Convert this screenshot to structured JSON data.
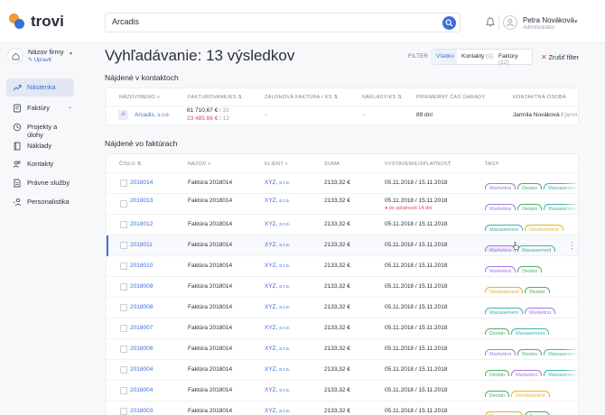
{
  "app": {
    "name": "trovi"
  },
  "search": {
    "value": "Arcadis"
  },
  "user": {
    "name": "Petra Nováková",
    "role": "Administrátor"
  },
  "company": {
    "name": "Názov firmy",
    "edit": "✎ Upraviť"
  },
  "nav": [
    {
      "label": "Nástenka",
      "icon": "trend-icon",
      "active": true
    },
    {
      "label": "Faktúry",
      "icon": "invoice-icon",
      "caret": "⌄"
    },
    {
      "label": "Projekty a úlohy",
      "icon": "clock-icon"
    },
    {
      "label": "Náklady",
      "icon": "book-icon"
    },
    {
      "label": "Kontakty",
      "icon": "people-icon"
    },
    {
      "label": "Právne služby",
      "icon": "document-icon"
    },
    {
      "label": "Personalistika",
      "icon": "person-link-icon"
    }
  ],
  "page": {
    "title": "Vyhľadávanie: 13 výsledkov"
  },
  "filter": {
    "label": "FILTER",
    "options": [
      {
        "label": "Všetko",
        "count": ""
      },
      {
        "label": "Kontakty",
        "count": "(1)"
      },
      {
        "label": "Faktúry",
        "count": "(12)"
      }
    ],
    "clear": "Zrušiť filter"
  },
  "contacts_section": {
    "title": "Nájdené v kontaktoch",
    "headers": [
      "NÁZOV/MENO",
      "FAKTUROVANÉ/KS",
      "ZÁLOHOVÁ FAKTÚRA / KS",
      "NÁKLADY/KS",
      "PRIEMERNÝ ČAS ÚHRADY",
      "KONTAKTNÁ OSOBA"
    ],
    "row": {
      "badge": "A",
      "name": "Arcadis, s.r.o.",
      "invoiced": "61 710,67 €",
      "invoiced_count": "/ 32",
      "invoiced_overdue": "23 485,66 €",
      "invoiced_overdue_count": "/ 12",
      "advance": "–",
      "costs": "–",
      "avg_time": "89 dní",
      "person": "Jarmila Nováková /",
      "person_extra": "jarmi"
    }
  },
  "invoices_section": {
    "title": "Nájdené vo faktúrach",
    "headers": [
      "ČÍSLO",
      "NÁZOV",
      "KLIENT",
      "SUMA",
      "VYSTAVENIE/SPLATNOSŤ",
      "TAGY"
    ],
    "rows": [
      {
        "number": "2018014",
        "name": "Faktúra 2018014",
        "client": "XYZ,",
        "client_suffix": "s.r.o.",
        "amount": "2133,32 €",
        "dates": "05.11.2018 / 15.11.2018",
        "note": "",
        "tags": [
          "Marketing",
          "Design",
          "Management"
        ]
      },
      {
        "number": "2018013",
        "name": "Faktúra 2018014",
        "client": "XYZ,",
        "client_suffix": "s.r.o.",
        "amount": "2133,32 €",
        "dates": "05.11.2018 / 15.11.2018",
        "note": "● po splatnosti 14 dní",
        "tags": [
          "Marketing",
          "Design",
          "Management"
        ]
      },
      {
        "number": "2018012",
        "name": "Faktúra 2018014",
        "client": "XYZ,",
        "client_suffix": "s.r.o.",
        "amount": "2133,32 €",
        "dates": "05.11.2018 / 15.11.2018",
        "note": "",
        "tags": [
          "Management",
          "Development"
        ]
      },
      {
        "number": "2018011",
        "name": "Faktúra 2018014",
        "client": "XYZ,",
        "client_suffix": "s.r.o.",
        "amount": "2133,32 €",
        "dates": "05.11.2018 / 15.11.2018",
        "note": "",
        "tags": [
          "Marketing",
          "Management"
        ]
      },
      {
        "number": "2018010",
        "name": "Faktúra 2018014",
        "client": "XYZ,",
        "client_suffix": "s.r.o.",
        "amount": "2133,32 €",
        "dates": "05.11.2018 / 15.11.2018",
        "note": "",
        "tags": [
          "Marketing",
          "Design"
        ]
      },
      {
        "number": "2018009",
        "name": "Faktúra 2018014",
        "client": "XYZ,",
        "client_suffix": "s.r.o.",
        "amount": "2133,32 €",
        "dates": "05.11.2018 / 15.11.2018",
        "note": "",
        "tags": [
          "Development",
          "Design"
        ]
      },
      {
        "number": "2018008",
        "name": "Faktúra 2018014",
        "client": "XYZ,",
        "client_suffix": "s.r.o.",
        "amount": "2133,32 €",
        "dates": "05.11.2018 / 15.11.2018",
        "note": "",
        "tags": [
          "Management",
          "Marketing"
        ]
      },
      {
        "number": "2018007",
        "name": "Faktúra 2018014",
        "client": "XYZ,",
        "client_suffix": "s.r.o.",
        "amount": "2133,32 €",
        "dates": "05.11.2018 / 15.11.2018",
        "note": "",
        "tags": [
          "Design",
          "Management"
        ]
      },
      {
        "number": "2018006",
        "name": "Faktúra 2018014",
        "client": "XYZ,",
        "client_suffix": "s.r.o.",
        "amount": "2133,32 €",
        "dates": "05.11.2018 / 15.11.2018",
        "note": "",
        "tags": [
          "Marketing",
          "Design",
          "Management"
        ]
      },
      {
        "number": "2018004",
        "name": "Faktúra 2018014",
        "client": "XYZ,",
        "client_suffix": "s.r.o.",
        "amount": "2133,32 €",
        "dates": "05.11.2018 / 15.11.2018",
        "note": "",
        "tags": [
          "Design",
          "Marketing",
          "Management"
        ]
      },
      {
        "number": "2018004",
        "name": "Faktúra 2018014",
        "client": "XYZ,",
        "client_suffix": "s.r.o.",
        "amount": "2133,32 €",
        "dates": "05.11.2018 / 15.11.2018",
        "note": "",
        "tags": [
          "Design",
          "Development"
        ]
      },
      {
        "number": "2018003",
        "name": "Faktúra 2018014",
        "client": "XYZ,",
        "client_suffix": "s.r.o.",
        "amount": "2133,32 €",
        "dates": "05.11.2018 / 15.11.2018",
        "note": "",
        "tags": [
          "Development",
          "Design"
        ]
      }
    ]
  },
  "tag_colors": {
    "Marketing": "#a07be0",
    "Design": "#4cae6a",
    "Management": "#3fb3a8",
    "Development": "#e2b52a"
  },
  "accent": "#3b6fd8"
}
